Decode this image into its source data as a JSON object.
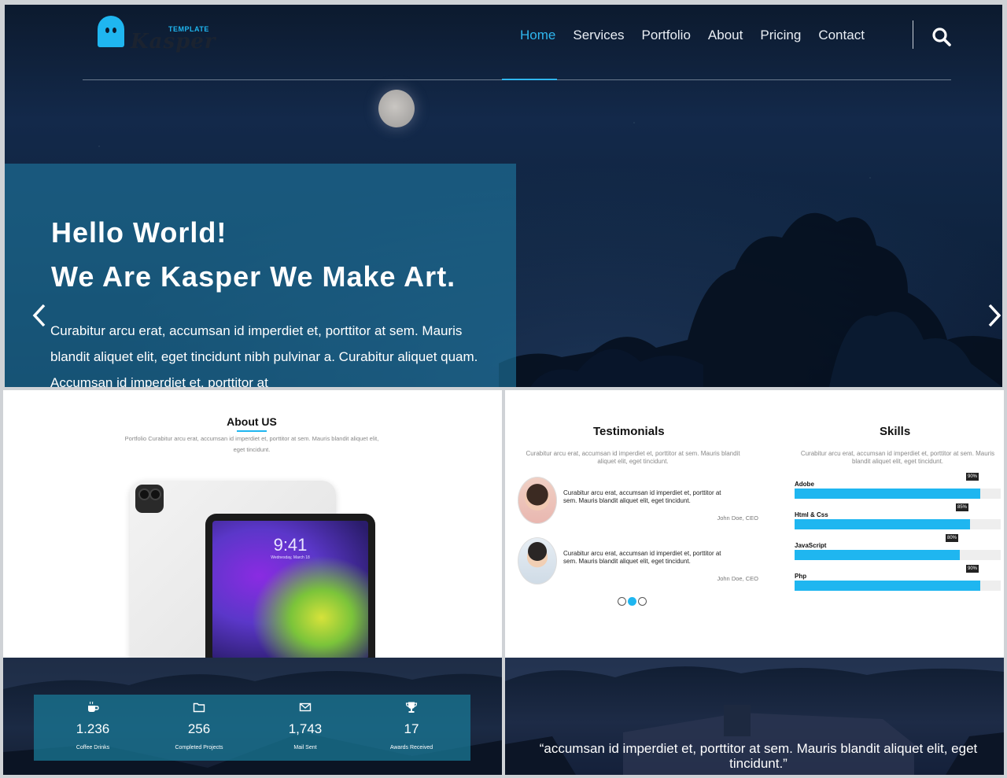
{
  "brand": {
    "name": "Kasper",
    "tag": "TEMPLATE",
    "accent": "#1fb6f0"
  },
  "nav": {
    "items": [
      "Home",
      "Services",
      "Portfolio",
      "About",
      "Pricing",
      "Contact"
    ],
    "active": "Home",
    "search_icon": "search-icon"
  },
  "hero": {
    "line1": "Hello World!",
    "line2": "We Are Kasper We Make Art.",
    "paragraph": "Curabitur arcu erat, accumsan id imperdiet et, porttitor at sem. Mauris blandit aliquet elit, eget tincidunt nibh pulvinar a. Curabitur aliquet quam. Accumsan id imperdiet et, porttitor at"
  },
  "about": {
    "title": "About US",
    "text": "Portfolio Curabitur arcu erat, accumsan id imperdiet et, porttitor at sem. Mauris blandit aliquet elit, eget tincidunt.",
    "device_time": "9:41",
    "device_date": "Wednesday, March 18"
  },
  "testimonials": {
    "title": "Testimonials",
    "subtitle": "Curabitur arcu erat, accumsan id imperdiet et, porttitor at sem. Mauris blandit aliquet elit, eget tincidunt.",
    "items": [
      {
        "text": "Curabitur arcu erat, accumsan id imperdiet et, porttitor at sem. Mauris blandit aliquet elit, eget tincidunt.",
        "author": "John Doe, CEO"
      },
      {
        "text": "Curabitur arcu erat, accumsan id imperdiet et, porttitor at sem. Mauris blandit aliquet elit, eget tincidunt.",
        "author": "John Doe, CEO"
      }
    ],
    "active_dot": 1
  },
  "skills": {
    "title": "Skills",
    "subtitle": "Curabitur arcu erat, accumsan id imperdiet et, porttitor at sem. Mauris blandit aliquet elit, eget tincidunt.",
    "items": [
      {
        "name": "Adobe",
        "percent": 90,
        "label": "90%"
      },
      {
        "name": "Html & Css",
        "percent": 85,
        "label": "85%"
      },
      {
        "name": "JavaScript",
        "percent": 80,
        "label": "80%"
      },
      {
        "name": "Php",
        "percent": 90,
        "label": "90%"
      }
    ]
  },
  "stats": [
    {
      "icon": "coffee-icon",
      "value": "1.236",
      "label": "Coffee Drinks"
    },
    {
      "icon": "folder-icon",
      "value": "256",
      "label": "Completed Projects"
    },
    {
      "icon": "mail-icon",
      "value": "1,743",
      "label": "Mail Sent"
    },
    {
      "icon": "trophy-icon",
      "value": "17",
      "label": "Awards Received"
    }
  ],
  "quote": {
    "text": "“accumsan id imperdiet et, porttitor at sem. Mauris blandit aliquet elit, eget tincidunt.”"
  }
}
